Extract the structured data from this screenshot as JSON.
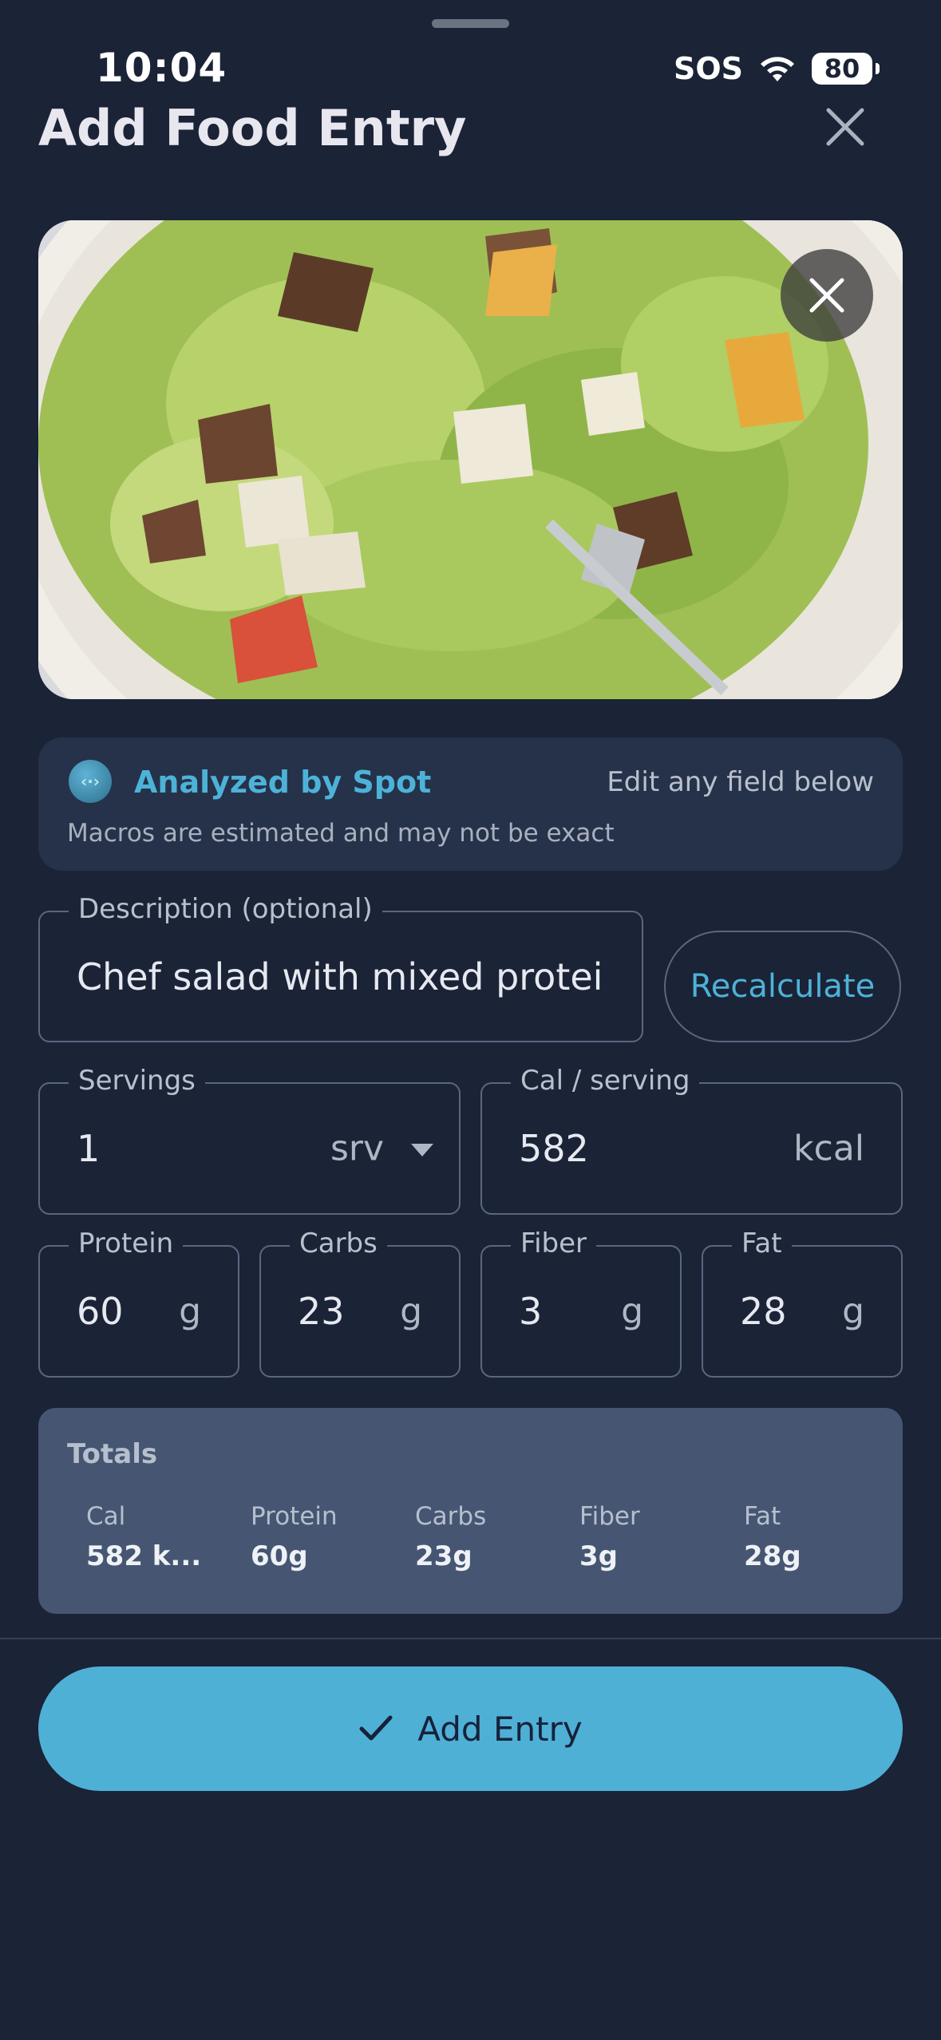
{
  "status_bar": {
    "time": "10:04",
    "sos": "SOS",
    "battery": "80"
  },
  "header": {
    "title": "Add Food Entry",
    "close_icon": "close-icon"
  },
  "photo": {
    "remove_icon": "close-icon"
  },
  "analysis": {
    "title": "Analyzed by Spot",
    "edit_hint": "Edit any field below",
    "note": "Macros are estimated and may not be exact",
    "logo_glyph": "‹·›"
  },
  "form": {
    "description": {
      "label": "Description (optional)",
      "value": "Chef salad with mixed protei"
    },
    "recalculate_label": "Recalculate",
    "servings": {
      "label": "Servings",
      "value": "1",
      "unit": "srv"
    },
    "cal_per_serving": {
      "label": "Cal / serving",
      "value": "582",
      "unit": "kcal"
    },
    "protein": {
      "label": "Protein",
      "value": "60",
      "unit": "g"
    },
    "carbs": {
      "label": "Carbs",
      "value": "23",
      "unit": "g"
    },
    "fiber": {
      "label": "Fiber",
      "value": "3",
      "unit": "g"
    },
    "fat": {
      "label": "Fat",
      "value": "28",
      "unit": "g"
    }
  },
  "totals": {
    "title": "Totals",
    "items": [
      {
        "label": "Cal",
        "value": "582 k..."
      },
      {
        "label": "Protein",
        "value": "60g"
      },
      {
        "label": "Carbs",
        "value": "23g"
      },
      {
        "label": "Fiber",
        "value": "3g"
      },
      {
        "label": "Fat",
        "value": "28g"
      }
    ]
  },
  "footer": {
    "add_label": "Add Entry",
    "check_icon": "check-icon"
  },
  "colors": {
    "background": "#1b2336",
    "accent": "#4fb0d6",
    "card": "#26324a",
    "totals_card": "#465672"
  }
}
